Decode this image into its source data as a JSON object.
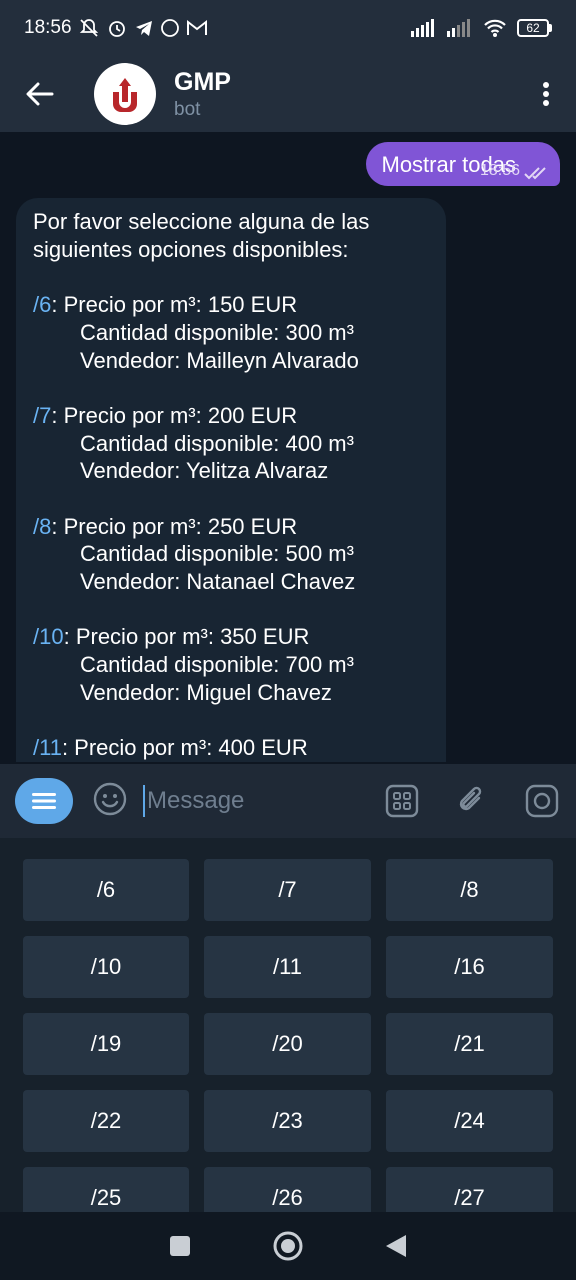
{
  "status_bar": {
    "time": "18:56",
    "battery": "62"
  },
  "header": {
    "title": "GMP",
    "subtitle": "bot"
  },
  "outgoing": {
    "text": "Mostrar todas",
    "time": "18:56"
  },
  "incoming": {
    "intro_1": "Por favor seleccione alguna de las",
    "intro_2": "siguientes opciones disponibles:",
    "offers": [
      {
        "cmd": "/6",
        "price": ": Precio por m³: 150 EUR",
        "qty": "Cantidad disponible: 300 m³",
        "seller": "Vendedor: Mailleyn Alvarado"
      },
      {
        "cmd": "/7",
        "price": ": Precio por m³: 200 EUR",
        "qty": "Cantidad disponible: 400 m³",
        "seller": "Vendedor: Yelitza Alvaraz"
      },
      {
        "cmd": "/8",
        "price": ": Precio por m³: 250 EUR",
        "qty": "Cantidad disponible: 500 m³",
        "seller": "Vendedor: Natanael Chavez"
      },
      {
        "cmd": "/10",
        "price": ": Precio por m³: 350 EUR",
        "qty": "Cantidad disponible: 700 m³",
        "seller": "Vendedor: Miguel Chavez"
      },
      {
        "cmd": "/11",
        "price": ": Precio por m³: 400 EUR"
      }
    ]
  },
  "composer": {
    "placeholder": "Message"
  },
  "keyboard": {
    "buttons": [
      "/6",
      "/7",
      "/8",
      "/10",
      "/11",
      "/16",
      "/19",
      "/20",
      "/21",
      "/22",
      "/23",
      "/24",
      "/25",
      "/26",
      "/27"
    ]
  },
  "colors": {
    "accent": "#5fa8e8",
    "outgoing_bubble": "#8055d6",
    "link": "#6ab3f3"
  }
}
